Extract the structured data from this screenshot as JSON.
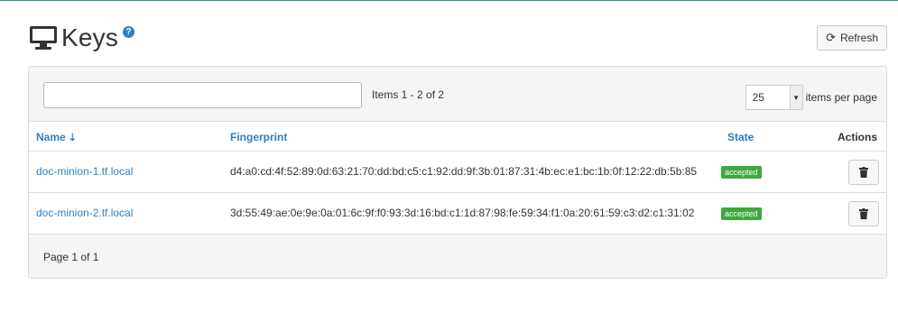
{
  "header": {
    "title": "Keys",
    "help_icon": "question-circle-icon",
    "refresh_label": "Refresh"
  },
  "toolbar": {
    "search_value": "",
    "items_range": "Items 1 - 2 of 2",
    "per_page_value": "25",
    "per_page_label": "items per page"
  },
  "table": {
    "columns": {
      "name": "Name",
      "fingerprint": "Fingerprint",
      "state": "State",
      "actions": "Actions"
    },
    "rows": [
      {
        "name": "doc-minion-1.tf.local",
        "fingerprint": "d4:a0:cd:4f:52:89:0d:63:21:70:dd:bd:c5:c1:92:dd:9f:3b:01:87:31:4b:ec:e1:bc:1b:0f:12:22:db:5b:85",
        "state": "accepted"
      },
      {
        "name": "doc-minion-2.tf.local",
        "fingerprint": "3d:55:49:ae:0e:9e:0a:01:6c:9f:f0:93:3d:16:bd:c1:1d:87:98:fe:59:34:f1:0a:20:61:59:c3:d2:c1:31:02",
        "state": "accepted"
      }
    ]
  },
  "footer": {
    "page_info": "Page 1 of 1"
  },
  "colors": {
    "link": "#2f7fc1",
    "accepted": "#3fa83f",
    "top_border": "#2e8b8b"
  }
}
